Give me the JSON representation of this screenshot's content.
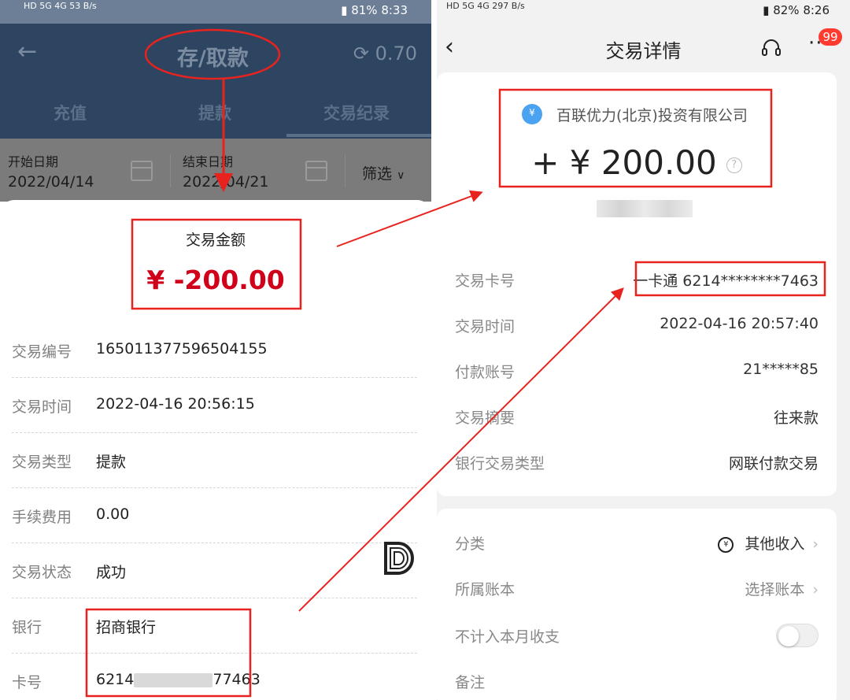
{
  "left_phone": {
    "status": {
      "left": "HD 5G 4G 53 B/s",
      "battery": "81%",
      "time": "8:33"
    },
    "header": {
      "back_icon": "back-arrow-icon",
      "title": "存/取款",
      "balance": "0.70",
      "balance_icon": "coin-icon"
    },
    "tabs": [
      {
        "label": "充值"
      },
      {
        "label": "提款"
      },
      {
        "label": "交易纪录"
      }
    ],
    "filter": {
      "start_label": "开始日期",
      "start_value": "2022/04/14",
      "end_label": "结束日期",
      "end_value": "2022/04/21",
      "filter_label": "筛选"
    },
    "detail": {
      "amount_label": "交易金额",
      "amount_value": "¥ -200.00",
      "rows": [
        {
          "label": "交易编号",
          "value": "165011377596504155"
        },
        {
          "label": "交易时间",
          "value": "2022-04-16 20:56:15"
        },
        {
          "label": "交易类型",
          "value": "提款"
        },
        {
          "label": "手续费用",
          "value": "0.00"
        },
        {
          "label": "交易状态",
          "value": "成功"
        },
        {
          "label": "银行",
          "value": "招商银行"
        },
        {
          "label": "卡号",
          "value_prefix": "6214",
          "value_suffix": "77463"
        }
      ]
    },
    "watermark_icon": "d-logo-icon"
  },
  "right_phone": {
    "status": {
      "left": "HD 5G 4G 297 B/s",
      "battery": "82%",
      "time": "8:26"
    },
    "nav": {
      "back_icon": "chevron-left-icon",
      "title": "交易详情",
      "support_icon": "headset-icon",
      "more_icon": "more-dots-icon",
      "badge": "99"
    },
    "company": "百联优力(北京)投资有限公司",
    "amount": "+ ¥ 200.00",
    "help_icon": "question-icon",
    "rows": [
      {
        "label": "交易卡号",
        "value": "一卡通 6214********7463"
      },
      {
        "label": "交易时间",
        "value": "2022-04-16 20:57:40"
      },
      {
        "label": "付款账号",
        "value": "21*****85"
      },
      {
        "label": "交易摘要",
        "value": "往来款"
      },
      {
        "label": "银行交易类型",
        "value": "网联付款交易"
      }
    ],
    "settings": [
      {
        "label": "分类",
        "value": "其他收入"
      },
      {
        "label": "所属账本",
        "value": "选择账本"
      },
      {
        "label": "不计入本月收支"
      },
      {
        "label": "备注"
      }
    ]
  },
  "colors": {
    "annotation_red": "#e8231f",
    "amount_red": "#d0021b",
    "header_dark": "#2d4560"
  }
}
